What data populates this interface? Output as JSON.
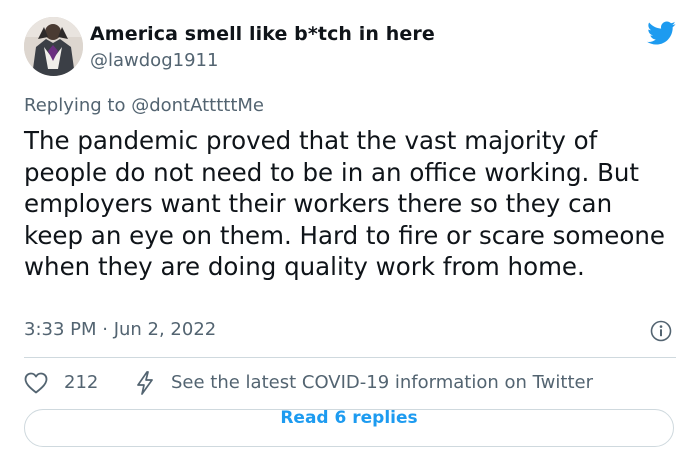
{
  "author": {
    "display_name": "America smell like b*tch in here",
    "handle": "@lawdog1911"
  },
  "reply_context": {
    "prefix": "Replying to ",
    "mention": "@dontAtttttMe"
  },
  "tweet": {
    "text": "The pandemic proved that the vast majority of people do not need to be in an office working. But employers want their workers there so they can keep an eye on them. Hard to fire or scare someone when they are doing quality work from home.",
    "timestamp": "3:33 PM · Jun 2, 2022"
  },
  "actions": {
    "like_count": "212",
    "covid_link": "See the latest COVID-19 information on Twitter"
  },
  "read_replies": {
    "label": "Read 6 replies"
  },
  "icons": {
    "brand": "twitter-bird-icon",
    "info": "info-icon",
    "like": "heart-icon",
    "covid": "lightning-icon"
  },
  "colors": {
    "brand": "#1d9bf0",
    "text_primary": "#0f1419",
    "text_secondary": "#536471",
    "divider": "#cfd9de"
  }
}
